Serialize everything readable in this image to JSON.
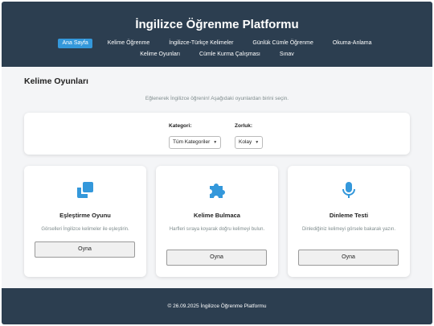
{
  "header": {
    "title": "İngilizce Öğrenme Platformu",
    "nav": [
      {
        "label": "Ana Sayfa",
        "active": true
      },
      {
        "label": "Kelime Öğrenme",
        "active": false
      },
      {
        "label": "İngilizce-Türkçe Kelimeler",
        "active": false
      },
      {
        "label": "Günlük Cümle Öğrenme",
        "active": false
      },
      {
        "label": "Okuma-Anlama",
        "active": false
      },
      {
        "label": "Kelime Oyunları",
        "active": false
      },
      {
        "label": "Cümle Kurma Çalışması",
        "active": false
      },
      {
        "label": "Sınav",
        "active": false
      }
    ]
  },
  "main": {
    "title": "Kelime Oyunları",
    "intro": "Eğlenerek İngilizce öğrenin! Aşağıdaki oyunlardan birini seçin.",
    "filters": {
      "category_label": "Kategori:",
      "category_value": "Tüm Kategoriler",
      "difficulty_label": "Zorluk:",
      "difficulty_value": "Kolay"
    },
    "games": [
      {
        "icon": "clone-icon",
        "title": "Eşleştirme Oyunu",
        "desc": "Görselleri İngilizce kelimeler ile eşleştirin.",
        "button": "Oyna"
      },
      {
        "icon": "puzzle-icon",
        "title": "Kelime Bulmaca",
        "desc": "Harfleri sıraya koyarak doğru kelimeyi bulun.",
        "button": "Oyna"
      },
      {
        "icon": "microphone-icon",
        "title": "Dinleme Testi",
        "desc": "Dinlediğiniz kelimeyi görsele bakarak yazın.",
        "button": "Oyna"
      }
    ]
  },
  "footer": {
    "text": "© 26.09.2025 İngilizce Öğrenme Platformu"
  },
  "colors": {
    "header_bg": "#2c3e50",
    "accent": "#3498db",
    "page_bg": "#f4f5f7"
  }
}
